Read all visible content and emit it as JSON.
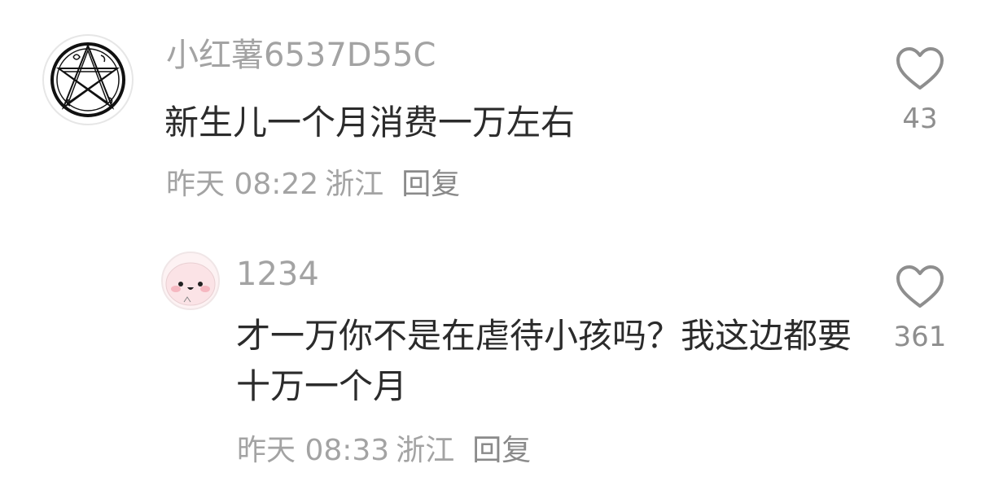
{
  "comments": [
    {
      "username": "小红薯6537D55C",
      "content": "新生儿一个月消费一万左右",
      "time": "昨天 08:22",
      "region": "浙江",
      "reply_label": "回复",
      "likes": "43",
      "avatar_icon": "occult-star-sigil-icon"
    },
    {
      "username": "1234",
      "content": "才一万你不是在虐待小孩吗？我这边都要十万一个月",
      "time": "昨天 08:33",
      "region": "浙江",
      "reply_label": "回复",
      "likes": "361",
      "avatar_icon": "pink-blob-face-icon"
    }
  ],
  "colors": {
    "username": "#a3a3a3",
    "content": "#2b2b2b",
    "meta": "#a3a3a3",
    "heart_outline": "#8e8e8e",
    "reply_avatar_bg": "#fdf2f3"
  }
}
